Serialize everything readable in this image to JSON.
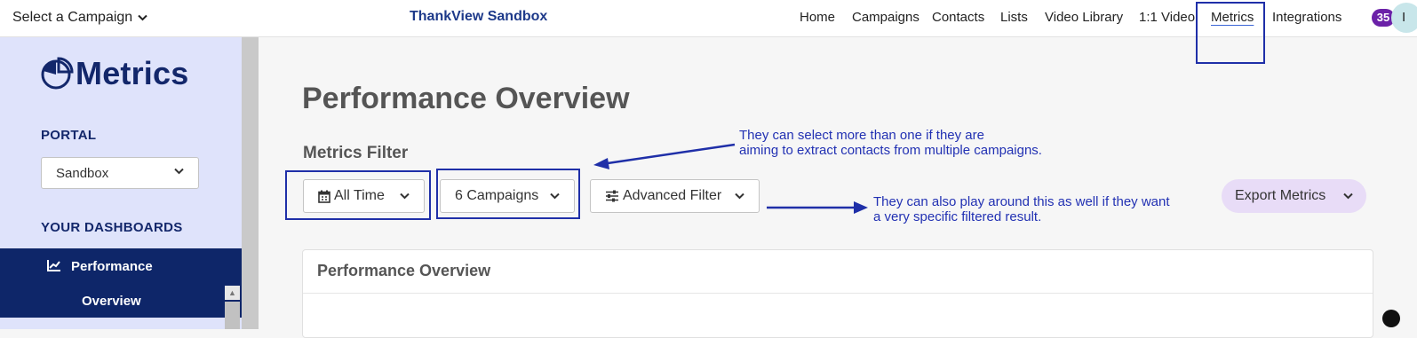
{
  "topbar": {
    "campaign_select": "Select a Campaign",
    "brand": "ThankView Sandbox",
    "nav": [
      "Home",
      "Campaigns",
      "Contacts",
      "Lists",
      "Video Library",
      "1:1 Video",
      "Metrics",
      "Integrations"
    ],
    "active_nav": "Metrics",
    "badge_count": "35",
    "avatar_initial": "I"
  },
  "sidebar": {
    "logo_text": "Metrics",
    "portal_label": "PORTAL",
    "portal_value": "Sandbox",
    "dashboards_label": "YOUR DASHBOARDS",
    "active_dashboard_line1": "Performance",
    "active_dashboard_line2": "Overview"
  },
  "main": {
    "page_title": "Performance Overview",
    "filter_heading": "Metrics Filter",
    "filters": {
      "date": "All Time",
      "campaigns": "6 Campaigns",
      "advanced": "Advanced Filter"
    },
    "export_label": "Export Metrics",
    "card_title": "Performance Overview"
  },
  "annotations": {
    "campaigns_note": [
      "They can select more than one if they are",
      "aiming to extract contacts from multiple campaigns."
    ],
    "advanced_note": [
      "They can also play around this as well if they want",
      "a very specific filtered result."
    ]
  },
  "colors": {
    "brand_navy": "#13276b",
    "sidebar_bg": "#dfe3fb",
    "active_item_bg": "#0e2669",
    "annotation_blue": "#2231b3",
    "export_bg": "#e8dcf7",
    "badge_purple": "#6b21a8"
  },
  "icons": {
    "campaign_chevron": "chevron-down-icon",
    "logo": "pie-chart-icon",
    "dashboard_item": "line-chart-icon",
    "date_filter": "calendar-icon",
    "advanced_filter": "sliders-icon"
  }
}
